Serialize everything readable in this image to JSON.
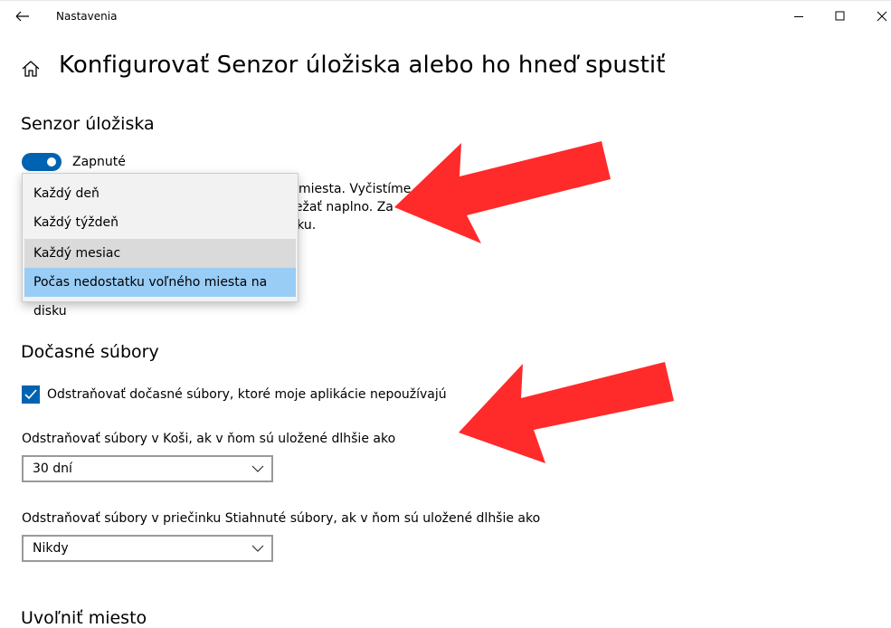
{
  "window": {
    "title": "Nastavenia",
    "back_icon": "arrow-left-icon",
    "minimize_icon": "minimize-icon",
    "maximize_icon": "maximize-icon",
    "close_icon": "close-icon"
  },
  "page": {
    "home_icon": "home-icon",
    "title": "Konfigurovať Senzor úložiska alebo ho hneď spustiť"
  },
  "storage_sense": {
    "heading": "Senzor úložiska",
    "toggle_state": "on",
    "toggle_label": "Zapnuté",
    "description_lines": [
      "o miesta. Vyčistíme",
      "bežať naplno. Za",
      "isku."
    ],
    "run_frequency_options": [
      "Každý deň",
      "Každý týždeň",
      "Každý mesiac",
      "Počas nedostatku voľného miesta na disku"
    ],
    "hovered_option": "Každý mesiac",
    "selected_option": "Počas nedostatku voľného miesta na disku"
  },
  "temp_files": {
    "heading": "Dočasné súbory",
    "delete_unused_checked": true,
    "delete_unused_label": "Odstraňovať dočasné súbory, ktoré moje aplikácie nepoužívajú",
    "recycle_bin_label": "Odstraňovať súbory v Koši, ak v ňom sú uložené dlhšie ako",
    "recycle_bin_value": "30 dní",
    "downloads_label": "Odstraňovať súbory v priečinku Stiahnuté súbory, ak v ňom sú uložené dlhšie ako",
    "downloads_value": "Nikdy"
  },
  "free_space": {
    "heading": "Uvoľniť miesto"
  },
  "colors": {
    "accent": "#0063b1",
    "selected_item": "#99cdf6",
    "hover_item": "#dadada",
    "annotation_arrow": "#ff2a2a"
  }
}
